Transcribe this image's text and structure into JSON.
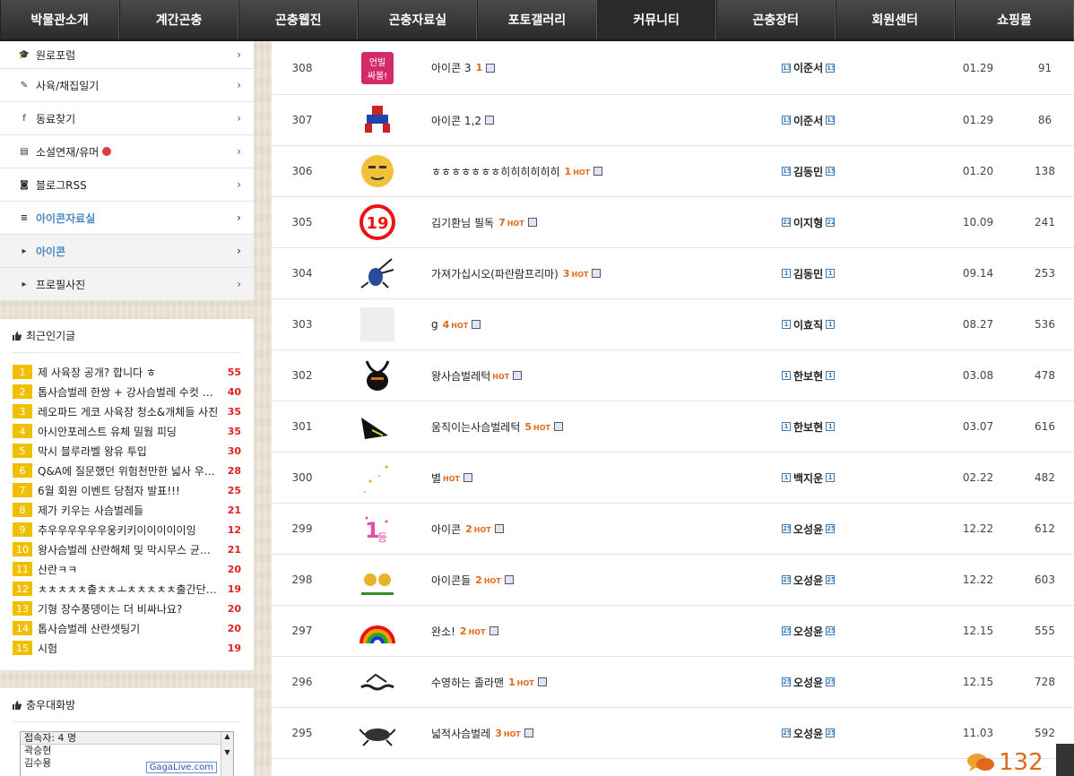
{
  "nav": {
    "items": [
      "박물관소개",
      "계간곤충",
      "곤충웹진",
      "곤충자료실",
      "포토갤러리",
      "커뮤니티",
      "곤충장터",
      "회원센터",
      "쇼핑몰"
    ],
    "active_index": 5
  },
  "sidebar": {
    "menu": [
      {
        "label": "원로포럼",
        "icon": "graduation-cap-icon"
      },
      {
        "label": "사육/채집일기",
        "icon": "pencil-icon"
      },
      {
        "label": "동료찾기",
        "icon": "facebook-icon"
      },
      {
        "label": "소설연재/유머",
        "icon": "book-icon",
        "dot": true
      },
      {
        "label": "블로그RSS",
        "icon": "rss-icon"
      },
      {
        "label": "아이콘자료실",
        "icon": "database-icon",
        "highlight": true
      },
      {
        "label": "아이콘",
        "icon": "caret-right-icon",
        "highlight": true,
        "sub": true
      },
      {
        "label": "프로필사진",
        "icon": "caret-right-icon",
        "sub": true
      }
    ],
    "popular": {
      "title": "최근인기글",
      "items": [
        {
          "rank": "1",
          "title": "제 사육장 공개? 합니다 ㅎ",
          "count": "55"
        },
        {
          "rank": "2",
          "title": "톱사슴벌레 한쌍 + 강사슴벌레 수컷 WI…",
          "count": "40"
        },
        {
          "rank": "3",
          "title": "레오파드 게코 사육장 청소&개체들 사진",
          "count": "35"
        },
        {
          "rank": "4",
          "title": "아시안포레스트 유체 밀웜 피딩",
          "count": "35"
        },
        {
          "rank": "5",
          "title": "막시 블루라벨 왕유 투입",
          "count": "30"
        },
        {
          "rank": "6",
          "title": "Q&A에 질문했던 위험천만한 넓사 우…",
          "count": "28"
        },
        {
          "rank": "7",
          "title": "6월 회원 이벤트 당첨자 발표!!!",
          "count": "25"
        },
        {
          "rank": "8",
          "title": "제가 키우는 사슴벌레들",
          "count": "21"
        },
        {
          "rank": "9",
          "title": "추우우우우우우웅키키이이이이이잉",
          "count": "12"
        },
        {
          "rank": "10",
          "title": "왕사슴벌레 산란해체 및 막시무스 균사…",
          "count": "21"
        },
        {
          "rank": "11",
          "title": "산란ㅋㅋ",
          "count": "20"
        },
        {
          "rank": "12",
          "title": "ㅊㅊㅊㅊㅊ출ㅊㅊㅗㅊㅊㅊㅊㅊ출간단 산…",
          "count": "19"
        },
        {
          "rank": "13",
          "title": "기형 장수풍뎅이는 더 비싸나요?",
          "count": "20"
        },
        {
          "rank": "14",
          "title": "톱사슴벌레 산란셋팅기",
          "count": "20"
        },
        {
          "rank": "15",
          "title": "시험",
          "count": "19"
        }
      ]
    },
    "chat": {
      "title": "충우대화방",
      "header": "접속자: 4 명",
      "users": [
        "곽승현",
        "김수용"
      ],
      "badge": "GagaLive.com"
    }
  },
  "posts": [
    {
      "num": "308",
      "title": "아이콘 3",
      "comments": "1",
      "hot": false,
      "author": "이준서",
      "level": "13",
      "date": "01.29",
      "views": "91",
      "thumb": "text-icon"
    },
    {
      "num": "307",
      "title": "아이콘 1,2",
      "comments": "",
      "hot": false,
      "author": "이준서",
      "level": "13",
      "date": "01.29",
      "views": "86",
      "thumb": "pixel-man-icon"
    },
    {
      "num": "306",
      "title": "ㅎㅎㅎㅎㅎㅎㅎ히히히히히히",
      "comments": "1",
      "hot": true,
      "author": "김동민",
      "level": "15",
      "date": "01.20",
      "views": "138",
      "thumb": "smiley-icon"
    },
    {
      "num": "305",
      "title": "김기환님 필독",
      "comments": "7",
      "hot": true,
      "author": "이지형",
      "level": "22",
      "date": "10.09",
      "views": "241",
      "thumb": "age-19-icon"
    },
    {
      "num": "304",
      "title": "가져가십시오(파란람프리마)",
      "comments": "3",
      "hot": true,
      "author": "김동민",
      "level": "1",
      "date": "09.14",
      "views": "253",
      "thumb": "beetle-icon"
    },
    {
      "num": "303",
      "title": "g",
      "comments": "4",
      "hot": true,
      "author": "이효직",
      "level": "1",
      "date": "08.27",
      "views": "536",
      "thumb": "blank-icon"
    },
    {
      "num": "302",
      "title": "왕사슴벌레턱",
      "comments": "",
      "hot": true,
      "author": "한보현",
      "level": "1",
      "date": "03.08",
      "views": "478",
      "thumb": "stag-beetle-icon"
    },
    {
      "num": "301",
      "title": "움직이는사슴벌레턱",
      "comments": "5",
      "hot": true,
      "author": "한보현",
      "level": "1",
      "date": "03.07",
      "views": "616",
      "thumb": "jaw-icon"
    },
    {
      "num": "300",
      "title": "별",
      "comments": "",
      "hot": true,
      "author": "백지운",
      "level": "1",
      "date": "02.22",
      "views": "482",
      "thumb": "star-icon"
    },
    {
      "num": "299",
      "title": "아이콘",
      "comments": "2",
      "hot": true,
      "author": "오성윤",
      "level": "25",
      "date": "12.22",
      "views": "612",
      "thumb": "first-place-icon"
    },
    {
      "num": "298",
      "title": "아이콘들",
      "comments": "2",
      "hot": true,
      "author": "오성윤",
      "level": "25",
      "date": "12.22",
      "views": "603",
      "thumb": "coins-icon"
    },
    {
      "num": "297",
      "title": "완소!",
      "comments": "2",
      "hot": true,
      "author": "오성윤",
      "level": "25",
      "date": "12.15",
      "views": "555",
      "thumb": "rainbow-icon"
    },
    {
      "num": "296",
      "title": "수영하는 졸라맨",
      "comments": "1",
      "hot": true,
      "author": "오성윤",
      "level": "25",
      "date": "12.15",
      "views": "728",
      "thumb": "swimmer-icon"
    },
    {
      "num": "295",
      "title": "넓적사슴벌레",
      "comments": "3",
      "hot": true,
      "author": "오성윤",
      "level": "25",
      "date": "11.03",
      "views": "592",
      "thumb": "beetle-photo-icon"
    }
  ],
  "hot_label": "HOT",
  "counter": "132"
}
